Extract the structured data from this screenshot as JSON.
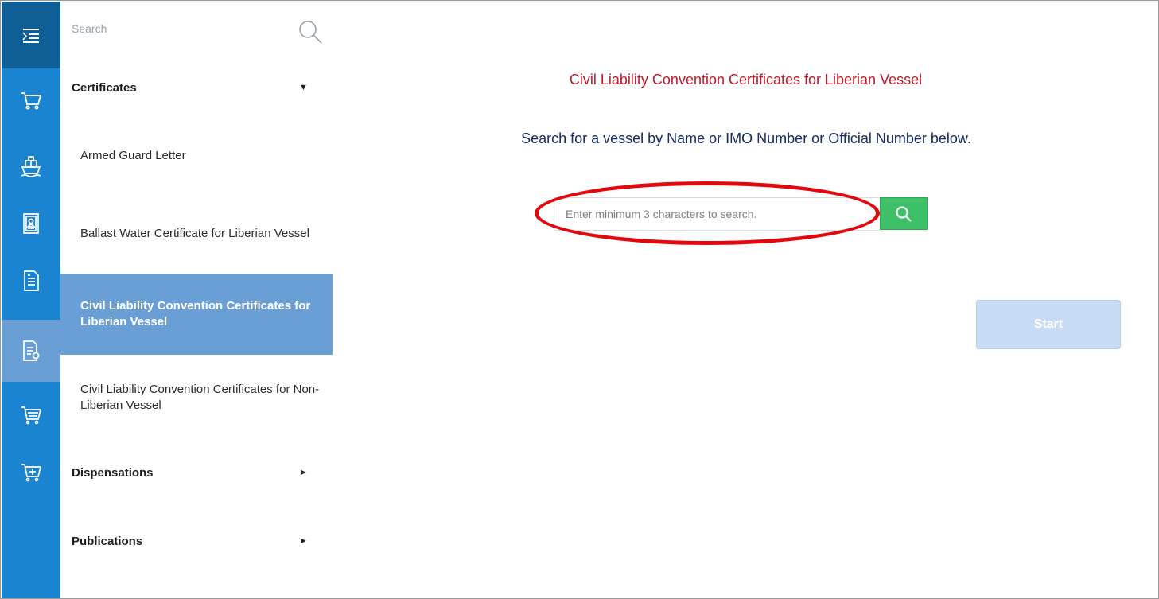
{
  "rail": {
    "items": [
      {
        "icon": "menu-toggle-icon"
      },
      {
        "icon": "cart-icon"
      },
      {
        "icon": "ship-icon"
      },
      {
        "icon": "id-card-icon"
      },
      {
        "icon": "document-icon"
      },
      {
        "icon": "certificate-icon"
      },
      {
        "icon": "cart-list-icon"
      },
      {
        "icon": "cart-add-icon"
      }
    ]
  },
  "menu": {
    "search_placeholder": "Search",
    "groups": [
      {
        "label": "Certificates",
        "caret": "▼"
      },
      {
        "label": "Dispensations",
        "caret": "►"
      },
      {
        "label": "Publications",
        "caret": "►"
      }
    ],
    "items": [
      {
        "label": "Armed Guard Letter"
      },
      {
        "label": "Ballast Water Certificate for Liberian Vessel"
      },
      {
        "label": "Civil Liability Convention Certificates for Liberian Vessel"
      },
      {
        "label": "Civil Liability Convention Certificates for Non-Liberian Vessel"
      }
    ]
  },
  "main": {
    "title": "Civil Liability Convention Certificates for Liberian Vessel",
    "subtitle": "Search for a vessel by Name or IMO Number or Official Number below.",
    "vessel_search_placeholder": "Enter minimum 3 characters to search.",
    "start_label": "Start"
  },
  "colors": {
    "rail": "#1b84d1",
    "rail_top": "#0f5f96",
    "active": "#6a9fd6",
    "title": "#c0192a",
    "subtitle": "#142a63",
    "search_button": "#3fbf67",
    "highlight": "#e3080e",
    "start_button": "#c7dcf4"
  }
}
